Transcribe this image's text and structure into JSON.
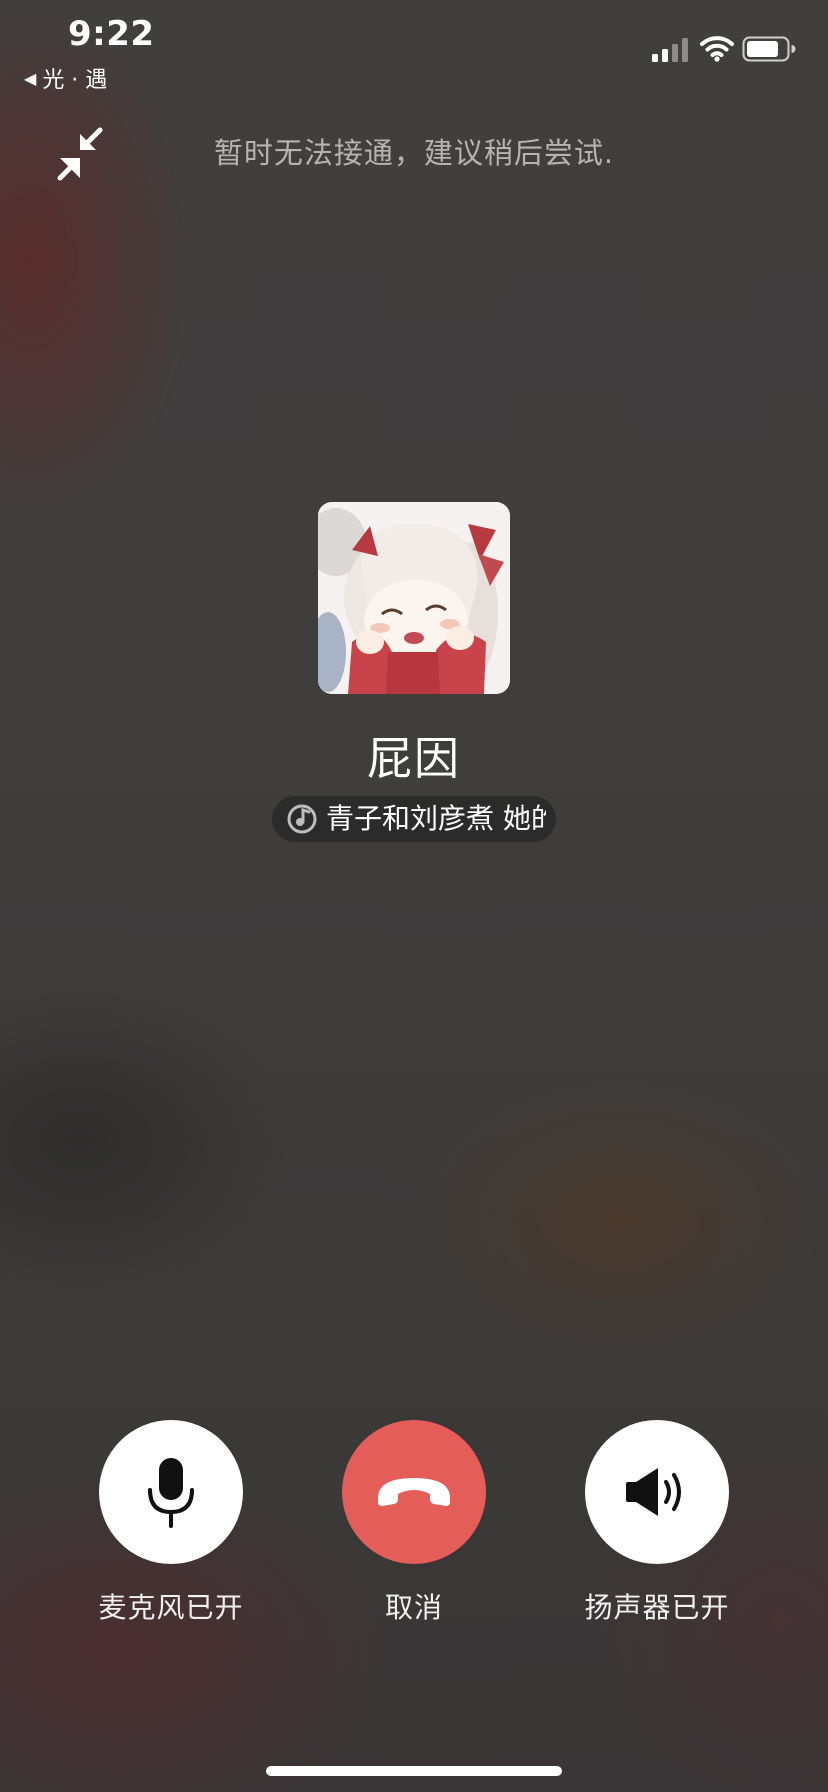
{
  "status_bar": {
    "time": "9:22",
    "back_app": "光 · 遇"
  },
  "call": {
    "status_text": "暂时无法接通，建议稍后尝试.",
    "contact_name": "屁因",
    "now_playing": "青子和刘彦煮   她的"
  },
  "controls": {
    "mic_label": "麦克风已开",
    "hangup_label": "取消",
    "speaker_label": "扬声器已开"
  },
  "colors": {
    "hangup_red": "#e55d59",
    "button_white": "#ffffff",
    "status_text_gray": "#b6b4b2"
  }
}
